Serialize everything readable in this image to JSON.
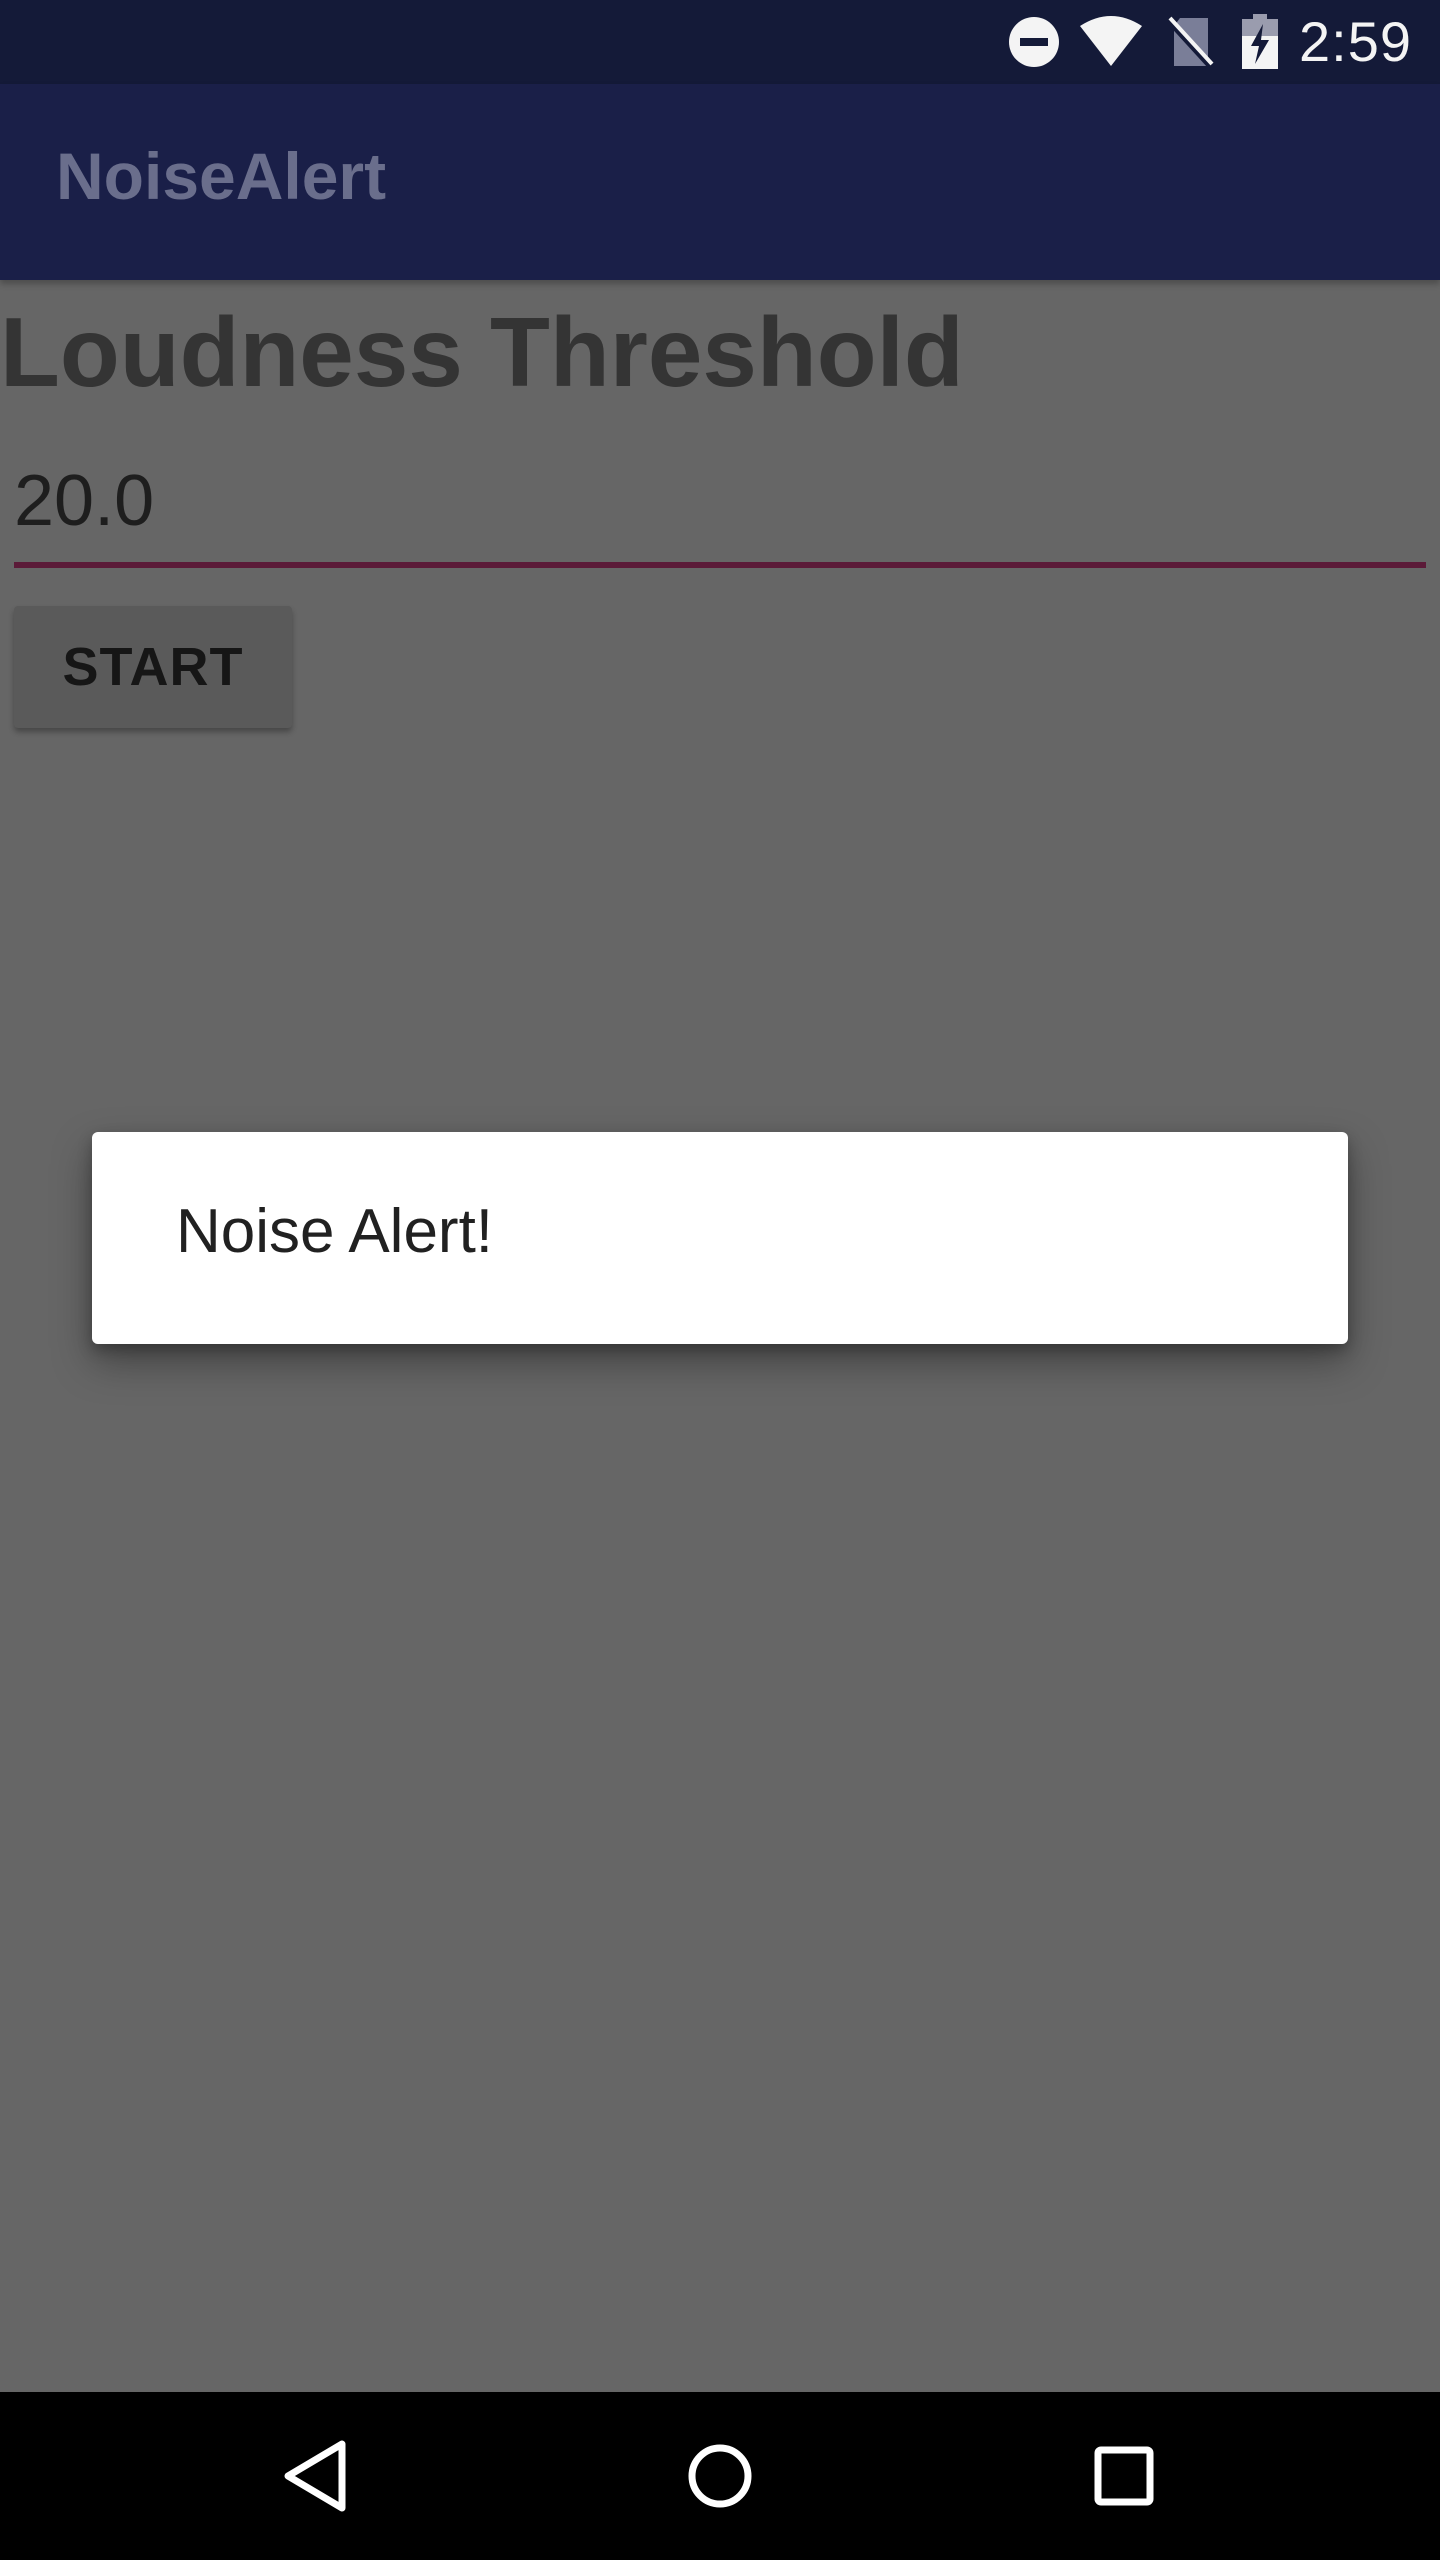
{
  "status_bar": {
    "time": "2:59",
    "icons": [
      "do-not-disturb-icon",
      "wifi-icon",
      "no-sim-icon",
      "battery-charging-icon"
    ]
  },
  "app_bar": {
    "title": "NoiseAlert"
  },
  "main": {
    "heading": "Loudness Threshold",
    "threshold_value": "20.0",
    "start_label": "START"
  },
  "dialog": {
    "message": "Noise Alert!"
  },
  "nav_bar": {
    "icons": [
      "back-icon",
      "home-icon",
      "recents-icon"
    ]
  },
  "colors": {
    "status_bar": "#141a38",
    "app_bar": "#1a1f48",
    "scrim_background": "#666666",
    "field_underline": "#5b1a38",
    "dialog_background": "#ffffff"
  }
}
